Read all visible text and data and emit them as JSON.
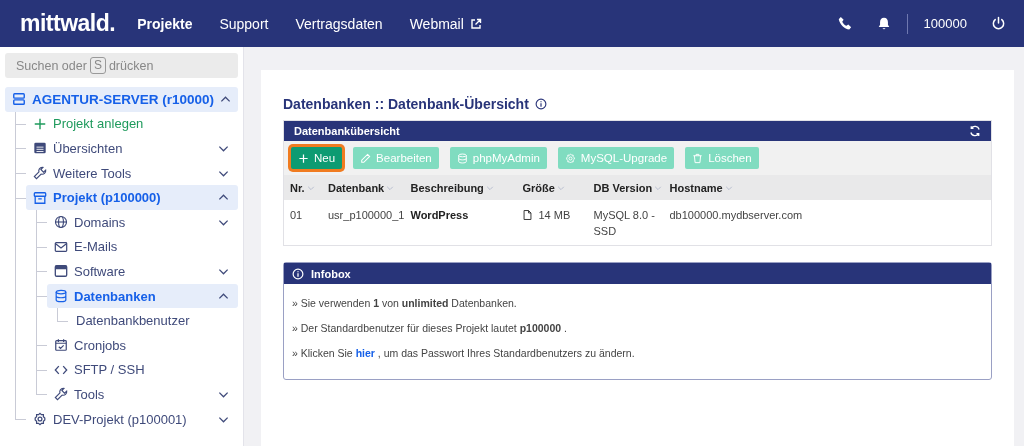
{
  "header": {
    "logo": "mittwald.",
    "nav": [
      {
        "label": "Projekte",
        "selected": true,
        "external": false
      },
      {
        "label": "Support",
        "selected": false,
        "external": false
      },
      {
        "label": "Vertragsdaten",
        "selected": false,
        "external": false
      },
      {
        "label": "Webmail",
        "selected": false,
        "external": true
      }
    ],
    "account": "100000"
  },
  "sidebar": {
    "search": {
      "placeholder_before": "Suchen oder",
      "key": "S",
      "placeholder_after": "drücken"
    },
    "tree": [
      {
        "label": "AGENTUR-SERVER (r10000)",
        "kind": "server",
        "selected": true,
        "expanded": true,
        "children": [
          {
            "label": "Projekt anlegen",
            "kind": "action"
          },
          {
            "label": "Übersichten",
            "kind": "overview",
            "selected": false,
            "expanded": false
          },
          {
            "label": "Weitere Tools",
            "kind": "wrench",
            "selected": false,
            "expanded": false
          },
          {
            "label": "Projekt (p100000)",
            "kind": "project",
            "selected": true,
            "expanded": true,
            "children": [
              {
                "label": "Domains",
                "kind": "globe",
                "selected": false,
                "expanded": false
              },
              {
                "label": "E-Mails",
                "kind": "mail",
                "selected": false
              },
              {
                "label": "Software",
                "kind": "window",
                "selected": false,
                "expanded": false
              },
              {
                "label": "Datenbanken",
                "kind": "database",
                "selected": true,
                "expanded": true,
                "children": [
                  {
                    "label": "Datenbankbenutzer",
                    "kind": "plain",
                    "selected": false
                  }
                ]
              },
              {
                "label": "Cronjobs",
                "kind": "calendar",
                "selected": false
              },
              {
                "label": "SFTP / SSH",
                "kind": "code",
                "selected": false
              },
              {
                "label": "Tools",
                "kind": "wrench",
                "selected": false,
                "expanded": false
              }
            ]
          },
          {
            "label": "DEV-Projekt (p100001)",
            "kind": "cog",
            "selected": false,
            "expanded": false
          }
        ]
      }
    ]
  },
  "page": {
    "title": "Datenbanken :: Datenbank-Übersicht",
    "panel": {
      "title": "Datenbankübersicht",
      "buttons": [
        {
          "label": "Neu",
          "kind": "plus",
          "disabled": false,
          "highlighted": true
        },
        {
          "label": "Bearbeiten",
          "kind": "pencil",
          "disabled": true,
          "highlighted": false
        },
        {
          "label": "phpMyAdmin",
          "kind": "database",
          "disabled": true,
          "highlighted": false
        },
        {
          "label": "MySQL-Upgrade",
          "kind": "cog",
          "disabled": true,
          "highlighted": false
        },
        {
          "label": "Löschen",
          "kind": "trash",
          "disabled": true,
          "highlighted": false
        }
      ],
      "columns": [
        "Nr.",
        "Datenbank",
        "Beschreibung",
        "Größe",
        "DB Version",
        "Hostname"
      ],
      "rows": [
        {
          "nr": "01",
          "datenbank": "usr_p100000_1",
          "beschreibung": "WordPress",
          "groesse": "14 MB",
          "db_version": "MySQL 8.0 - SSD",
          "hostname": "db100000.mydbserver.com"
        }
      ]
    },
    "infobox": {
      "title": "Infobox",
      "lines": [
        {
          "text": "» Sie verwenden **1** von **unlimited** Datenbanken."
        },
        {
          "text": "» Der Standardbenutzer für dieses Projekt lautet **p100000** ."
        },
        {
          "text": "» Klicken Sie",
          "link": "hier",
          "after": ", um das Passwort Ihres Standardbenutzers zu ändern."
        }
      ]
    }
  }
}
